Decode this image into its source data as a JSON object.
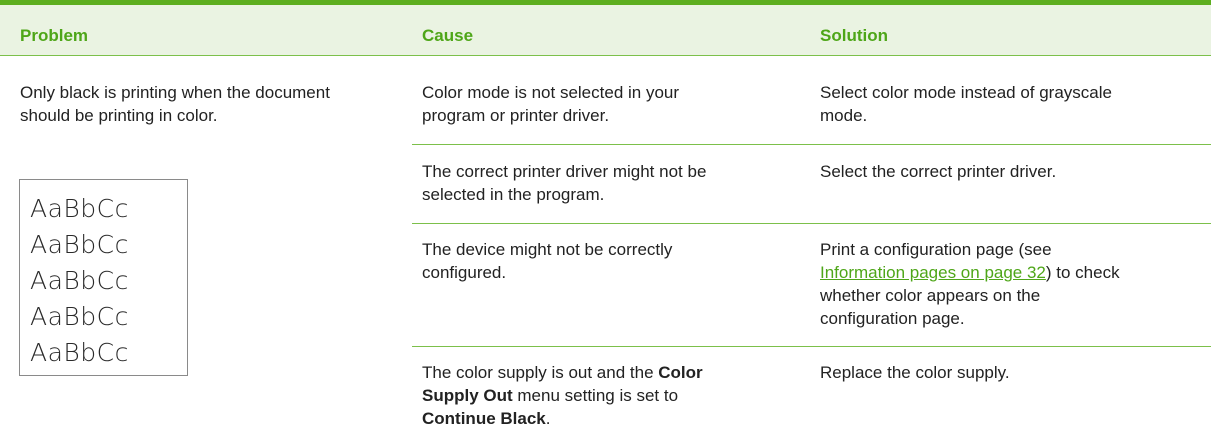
{
  "table": {
    "headers": {
      "problem": "Problem",
      "cause": "Cause",
      "solution": "Solution"
    },
    "problem": {
      "text_line1": "Only black is printing when the document",
      "text_line2": "should be printing in color.",
      "sample_text": [
        "AaBbCc",
        "AaBbCc",
        "AaBbCc",
        "AaBbCc",
        "AaBbCc"
      ]
    },
    "rows": [
      {
        "cause_lines": [
          "Color mode is not selected in your",
          "program or printer driver."
        ],
        "solution_lines": [
          "Select color mode instead of grayscale",
          "mode."
        ]
      },
      {
        "cause_lines": [
          "The correct printer driver might not be",
          "selected in the program."
        ],
        "solution_lines": [
          "Select the correct printer driver."
        ]
      },
      {
        "cause_lines": [
          "The device might not be correctly",
          "configured."
        ],
        "solution": {
          "line1": "Print a configuration page (see",
          "link_text": "Information pages on page 32",
          "line2_after_link": ") to check",
          "line3": "whether color appears on the",
          "line4": "configuration page."
        }
      },
      {
        "cause": {
          "line1_prefix": "The color supply is out and the ",
          "line1_bold": "Color",
          "line2_bold": "Supply Out",
          "line2_suffix": " menu setting is set to",
          "line3_bold": "Continue Black",
          "line3_suffix": "."
        },
        "solution_lines": [
          "Replace the color supply."
        ]
      }
    ]
  },
  "colors": {
    "accent_green": "#5dae1f",
    "header_text_green": "#4ea618",
    "header_bg": "#eaf3e2",
    "row_rule": "#7cc04a"
  }
}
